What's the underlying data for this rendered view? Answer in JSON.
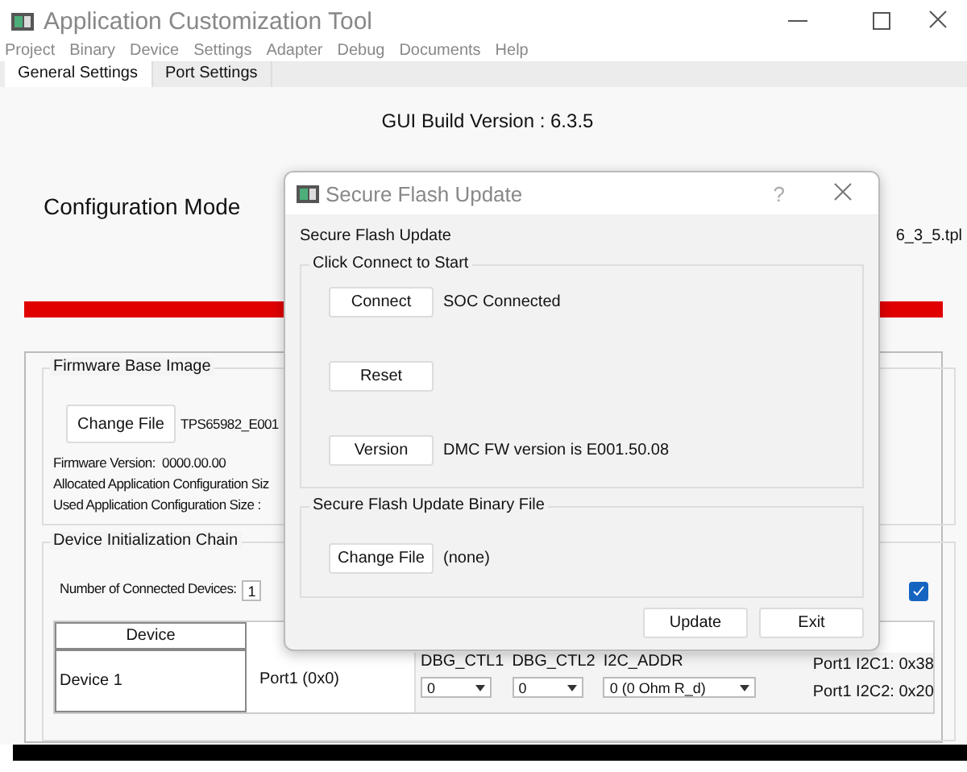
{
  "window": {
    "title": "Application Customization Tool"
  },
  "menu": [
    "Project",
    "Binary",
    "Device",
    "Settings",
    "Adapter",
    "Debug",
    "Documents",
    "Help"
  ],
  "tabs": [
    {
      "label": "General Settings",
      "selected": true
    },
    {
      "label": "Port Settings",
      "selected": false
    }
  ],
  "general": {
    "gui_build_version": "GUI Build Version : 6.3.5",
    "configuration_mode": "Configuration Mode",
    "file_suffix": "6_3_5.tpl",
    "firmware_base_image": {
      "title": "Firmware Base Image",
      "button": "Change File",
      "file_name": "TPS65982_E001",
      "lines": [
        "Firmware Version:  0000.00.00",
        "Allocated Application Configuration Siz",
        "Used Application Configuration Size :"
      ]
    },
    "device_chain": {
      "title": "Device Initialization Chain",
      "count_label": "Number of Connected Devices:",
      "count_value": "1",
      "checkbox": {
        "checked": true
      },
      "table": {
        "header": "Device",
        "rows": [
          {
            "device": "Device 1",
            "port": "Port1 (0x0)"
          }
        ]
      },
      "registers": [
        {
          "label": "DBG_CTL1",
          "value": "0"
        },
        {
          "label": "DBG_CTL2",
          "value": "0"
        },
        {
          "label": "I2C_ADDR",
          "value": "0 (0 Ohm R_d)"
        }
      ],
      "i2c": [
        "Port1 I2C1: 0x38",
        "Port1 I2C2: 0x20"
      ]
    }
  },
  "dialog": {
    "title": "Secure Flash Update",
    "help": "?",
    "heading": "Secure Flash Update",
    "connect_group": {
      "title": "Click Connect to Start",
      "rows": [
        {
          "button": "Connect",
          "status": "SOC Connected"
        },
        {
          "button": "Reset"
        },
        {
          "button": "Version",
          "status": "DMC FW version is E001.50.08"
        }
      ]
    },
    "binary_group": {
      "title": "Secure Flash Update Binary File",
      "button": "Change File",
      "status": "(none)"
    },
    "buttons": [
      "Update",
      "Exit"
    ]
  }
}
